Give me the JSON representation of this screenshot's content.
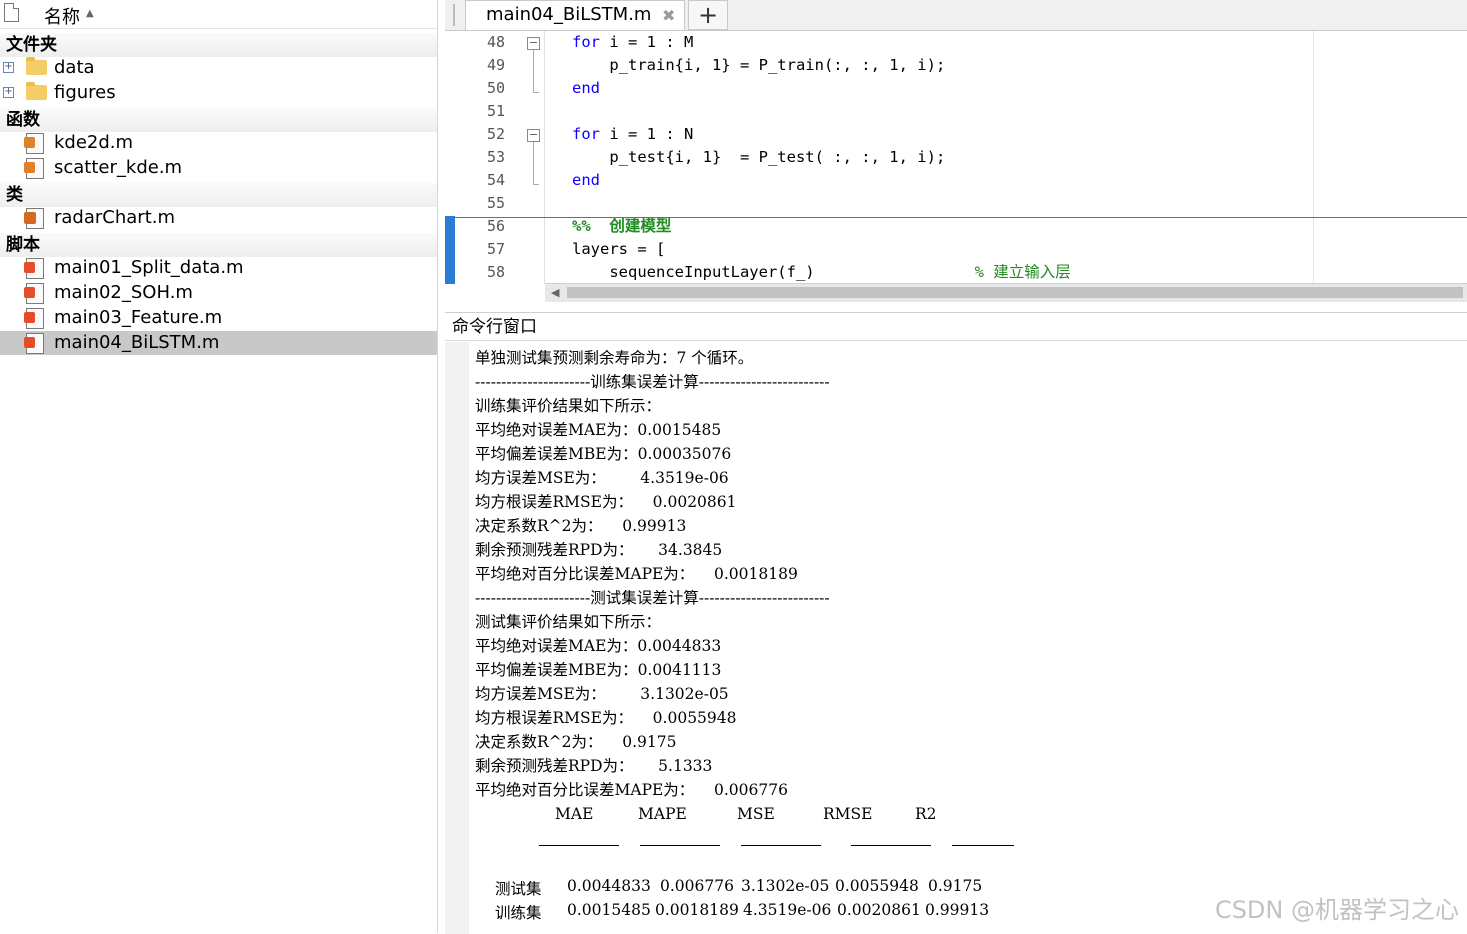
{
  "file_browser": {
    "column_name": "名称",
    "groups": {
      "folders": "文件夹",
      "functions": "函数",
      "classes": "类",
      "scripts": "脚本"
    },
    "folders": [
      {
        "label": "data"
      },
      {
        "label": "figures"
      }
    ],
    "functions": [
      {
        "label": "kde2d.m"
      },
      {
        "label": "scatter_kde.m"
      }
    ],
    "classes": [
      {
        "label": "radarChart.m"
      }
    ],
    "scripts": [
      {
        "label": "main01_Split_data.m"
      },
      {
        "label": "main02_SOH.m"
      },
      {
        "label": "main03_Feature.m"
      },
      {
        "label": "main04_BiLSTM.m",
        "selected": true
      }
    ]
  },
  "editor": {
    "tab_label": "main04_BiLSTM.m",
    "close_glyph": "✖",
    "add_glyph": "+",
    "line_numbers": [
      "48",
      "49",
      "50",
      "51",
      "52",
      "53",
      "54",
      "55",
      "56",
      "57",
      "58"
    ],
    "lines": {
      "l48": {
        "kw": "for",
        "rest": " i = 1 : M"
      },
      "l49": {
        "text": "    p_train{i, 1} = P_train(:, :, 1, i);"
      },
      "l50": {
        "kw": "end"
      },
      "l52": {
        "kw": "for",
        "rest": " i = 1 : N"
      },
      "l53": {
        "text": "    p_test{i, 1}  = P_test( :, :, 1, i);"
      },
      "l54": {
        "kw": "end"
      },
      "l56": {
        "text": "%%  创建模型"
      },
      "l57": {
        "text": "layers = ["
      },
      "l58": {
        "code": "    sequenceInputLayer(f_)",
        "comment": "% 建立输入层"
      }
    }
  },
  "command_window": {
    "title": "命令行窗口",
    "lines": [
      "单独测试集预测剩余寿命为：7 个循环。",
      "----------------------训练集误差计算-------------------------",
      "训练集评价结果如下所示：",
      "平均绝对误差MAE为：0.0015485",
      "平均偏差误差MBE为：0.00035076",
      "均方误差MSE为：       4.3519e-06",
      "均方根误差RMSE为：    0.0020861",
      "决定系数R^2为：    0.99913",
      "剩余预测残差RPD为：     34.3845",
      "平均绝对百分比误差MAPE为：    0.0018189",
      "----------------------测试集误差计算-------------------------",
      "测试集评价结果如下所示：",
      "平均绝对误差MAE为：0.0044833",
      "平均偏差误差MBE为：0.0041113",
      "均方误差MSE为：       3.1302e-05",
      "均方根误差RMSE为：    0.0055948",
      "决定系数R^2为：    0.9175",
      "剩余预测残差RPD为：     5.1333",
      "平均绝对百分比误差MAPE为：    0.006776"
    ],
    "table": {
      "headers": [
        "MAE",
        "MAPE",
        "MSE",
        "RMSE",
        "R2"
      ],
      "rows": [
        {
          "name": "测试集",
          "values": [
            "0.0044833",
            "0.006776",
            "3.1302e-05",
            "0.0055948",
            "0.9175"
          ]
        },
        {
          "name": "训练集",
          "values": [
            "0.0015485",
            "0.0018189",
            "4.3519e-06",
            "0.0020861",
            "0.99913"
          ]
        }
      ]
    }
  },
  "watermark": "CSDN @机器学习之心"
}
